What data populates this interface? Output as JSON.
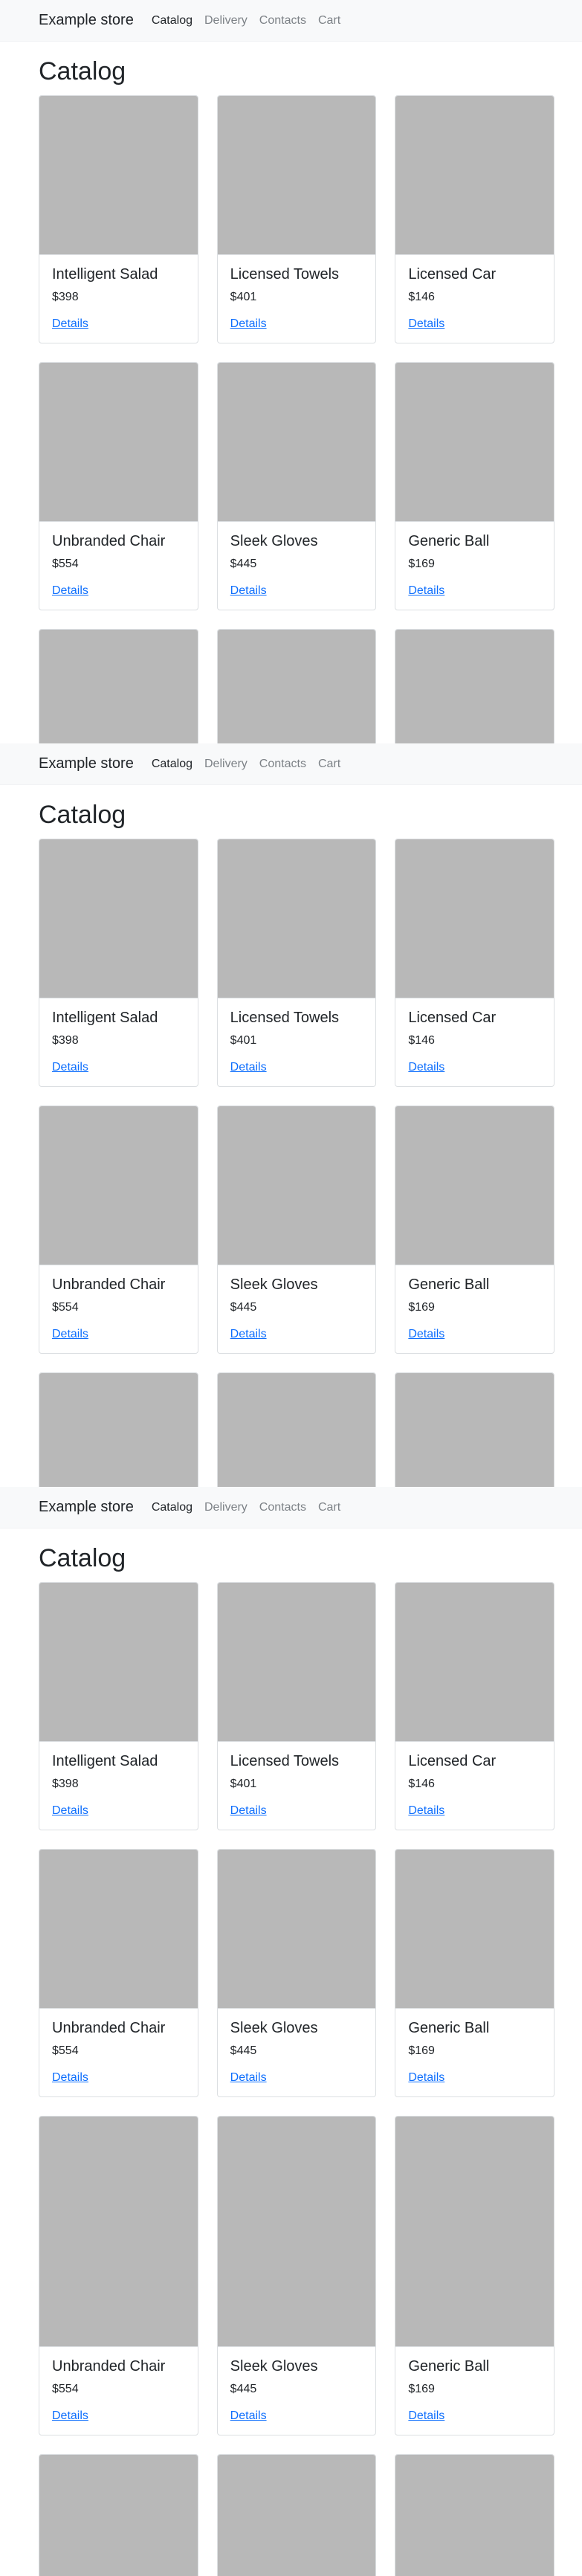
{
  "nav": {
    "brand": "Example store",
    "links": [
      "Catalog",
      "Delivery",
      "Contacts",
      "Cart"
    ]
  },
  "page_title": "Catalog",
  "products": [
    {
      "name": "Intelligent Salad",
      "price": "$398",
      "link": "Details"
    },
    {
      "name": "Licensed Towels",
      "price": "$401",
      "link": "Details"
    },
    {
      "name": "Licensed Car",
      "price": "$146",
      "link": "Details"
    },
    {
      "name": "Unbranded Chair",
      "price": "$554",
      "link": "Details"
    },
    {
      "name": "Sleek Gloves",
      "price": "$445",
      "link": "Details"
    },
    {
      "name": "Generic Ball",
      "price": "$169",
      "link": "Details"
    }
  ],
  "colors": {
    "navbar_bg": "#f8f9fa",
    "placeholder": "#b8b8b8",
    "link": "#0d6efd"
  }
}
